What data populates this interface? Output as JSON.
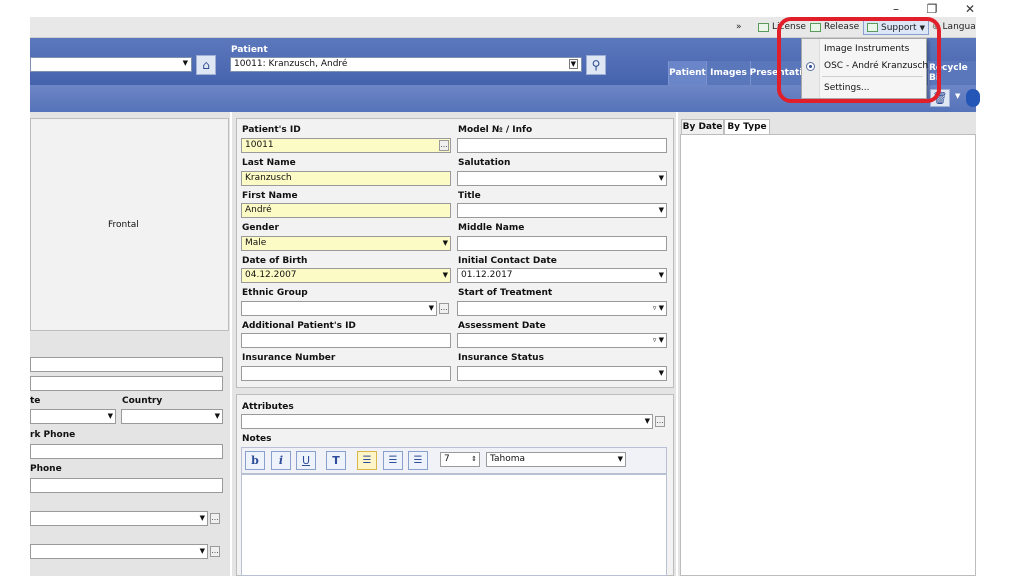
{
  "window": {
    "minimize": "–",
    "restore": "❐",
    "close": "✕"
  },
  "topbar": {
    "more": "»",
    "items": [
      {
        "label": "License",
        "icon": "checkbox-icon"
      },
      {
        "label": "Release",
        "icon": "checkbox-icon"
      },
      {
        "label": "Support",
        "icon": "checkbox-icon",
        "has_dropdown": true
      },
      {
        "label": "Langua",
        "icon": "globe-icon"
      }
    ]
  },
  "support_menu": {
    "items": [
      {
        "label": "Image Instruments",
        "selected": false
      },
      {
        "label": "OSC - André Kranzusch",
        "selected": true
      },
      {
        "label": "Settings..."
      }
    ]
  },
  "header": {
    "patient_label": "Patient",
    "patient_value": "10011: Kranzusch, André",
    "tabs": [
      "Patient",
      "Images",
      "Presentati",
      "Recycle Bi"
    ]
  },
  "left_panel": {
    "frontal_label": "Frontal",
    "state_label": "te",
    "country_label": "Country",
    "work_phone_label": "rk Phone",
    "phone_label": "Phone"
  },
  "form": {
    "patient_id_label": "Patient's ID",
    "patient_id_value": "10011",
    "model_label": "Model № / Info",
    "last_name_label": "Last Name",
    "last_name_value": "Kranzusch",
    "salutation_label": "Salutation",
    "first_name_label": "First Name",
    "first_name_value": "André",
    "title_label": "Title",
    "gender_label": "Gender",
    "gender_value": "Male",
    "middle_name_label": "Middle Name",
    "dob_label": "Date of Birth",
    "dob_value": "04.12.2007",
    "initial_contact_label": "Initial Contact Date",
    "initial_contact_value": "01.12.2017",
    "ethnic_group_label": "Ethnic Group",
    "start_treatment_label": "Start of Treatment",
    "additional_id_label": "Additional Patient's ID",
    "assessment_date_label": "Assessment Date",
    "insurance_number_label": "Insurance Number",
    "insurance_status_label": "Insurance Status"
  },
  "notes_panel": {
    "attributes_label": "Attributes",
    "notes_label": "Notes",
    "toolbar": {
      "bold": "b",
      "italic": "i",
      "underline": "U",
      "text_color": "T",
      "font_size": "7",
      "font_name": "Tahoma"
    }
  },
  "right_panel": {
    "tabs": [
      "By Date",
      "By Type"
    ]
  },
  "colors": {
    "header_blue": "#4f6cb5",
    "highlight_red": "#e01f2a",
    "required_yellow": "#fdfbc5"
  }
}
